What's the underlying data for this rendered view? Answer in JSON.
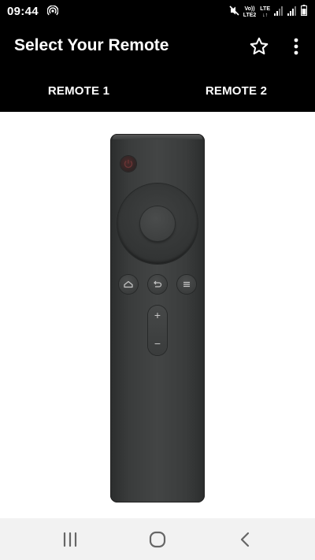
{
  "status_bar": {
    "time": "09:44",
    "volte_top": "Vo))",
    "volte_bottom": "LTE2",
    "lte_top": "LTE",
    "lte_bottom": "↓↑"
  },
  "app_bar": {
    "title": "Select Your Remote",
    "favorite_icon": "star-outline-icon",
    "overflow_icon": "more-vertical-icon"
  },
  "tabs": [
    {
      "label": "REMOTE 1"
    },
    {
      "label": "REMOTE 2"
    }
  ],
  "remote": {
    "buttons": [
      "power",
      "dpad",
      "ok",
      "home",
      "back",
      "menu",
      "volume-up",
      "volume-down"
    ],
    "colors": {
      "body": "#3c3e3e",
      "power_accent": "#4a2b2b"
    },
    "volume_plus": "+",
    "volume_minus": "−"
  },
  "nav_bar": {
    "recent_icon": "recent-apps-icon",
    "home_icon": "home-circle-icon",
    "back_icon": "back-chevron-icon"
  },
  "colors": {
    "app_bar": "#000000",
    "tab_text": "#ffffff",
    "nav_bar": "#f2f2f2"
  }
}
